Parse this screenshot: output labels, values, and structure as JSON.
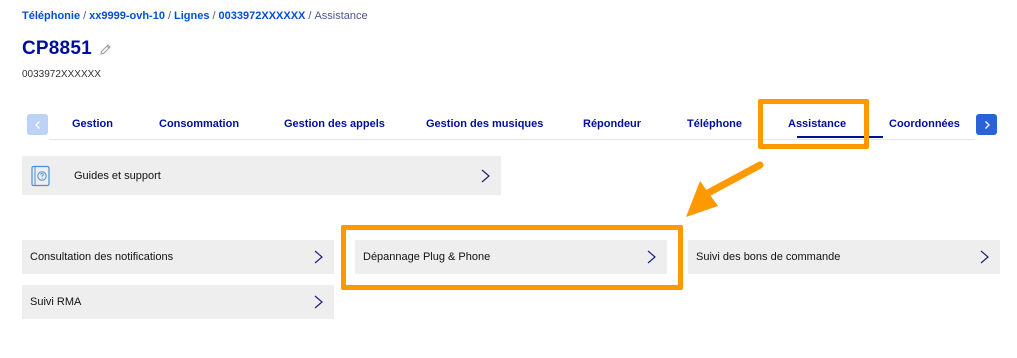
{
  "breadcrumb": {
    "items": [
      "Téléphonie",
      "xx9999-ovh-10",
      "Lignes",
      "0033972XXXXXX"
    ],
    "current": "Assistance",
    "separator": "/"
  },
  "page": {
    "title": "CP8851",
    "subtitle": "0033972XXXXXX"
  },
  "tabs": {
    "items": [
      "Gestion",
      "Consommation",
      "Gestion des appels",
      "Gestion des musiques",
      "Répondeur",
      "Téléphone",
      "Assistance",
      "Coordonnées"
    ],
    "active": "Assistance"
  },
  "cards": {
    "guides": "Guides et support",
    "notifications": "Consultation des notifications",
    "plug_phone": "Dépannage Plug & Phone",
    "orders": "Suivi des bons de commande",
    "rma": "Suivi RMA"
  },
  "icons": {
    "edit": "pencil-icon",
    "prev": "chevron-left-icon",
    "next": "chevron-right-icon",
    "card_arrow": "chevron-right-icon",
    "guides": "guide-book-icon"
  },
  "colors": {
    "primary_text": "#000e9c",
    "link": "#0050d7",
    "highlight": "#ff9900",
    "card_bg": "#eeeeee"
  }
}
